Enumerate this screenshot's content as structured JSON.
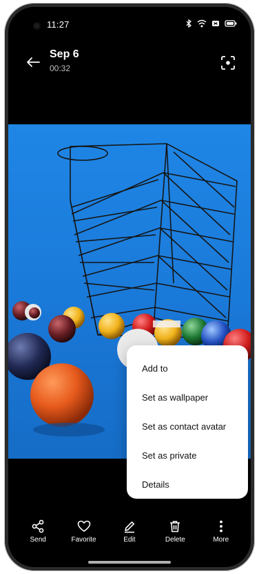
{
  "status": {
    "time": "11:27"
  },
  "header": {
    "title": "Sep 6",
    "subtitle": "00:32"
  },
  "menu": {
    "items": [
      {
        "label": "Add to"
      },
      {
        "label": "Set as wallpaper"
      },
      {
        "label": "Set as contact avatar"
      },
      {
        "label": "Set as private"
      },
      {
        "label": "Details"
      }
    ]
  },
  "toolbar": {
    "send": "Send",
    "favorite": "Favorite",
    "edit": "Edit",
    "delete": "Delete",
    "more": "More"
  },
  "colors": {
    "photo_background": "#1f86e6",
    "menu_background": "#ffffff",
    "toolbar_background": "#000000"
  }
}
